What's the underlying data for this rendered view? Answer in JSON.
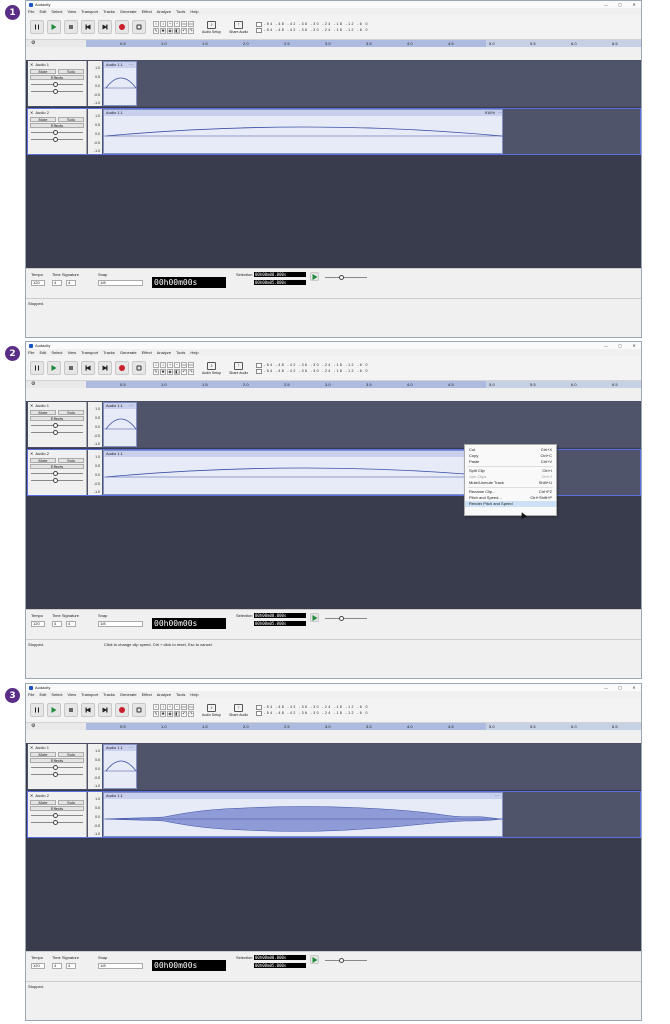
{
  "app": {
    "title": "Audacity",
    "menu": [
      "File",
      "Edit",
      "Select",
      "View",
      "Transport",
      "Tracks",
      "Generate",
      "Effect",
      "Analyze",
      "Tools",
      "Help"
    ]
  },
  "toolbar": {
    "audio_setup": "Audio Setup",
    "share_audio": "Share Audio",
    "meter_scale": "-54 -48 -42 -36 -30 -24 -18 -12 -6 0"
  },
  "ruler": {
    "ticks": [
      "0.5",
      "1.0",
      "1.5",
      "2.0",
      "2.5",
      "3.0",
      "3.5",
      "4.0",
      "4.5",
      "5.0",
      "5.5",
      "6.0",
      "6.5"
    ]
  },
  "tracks": [
    {
      "name": "Audio 1",
      "mute": "Mute",
      "solo": "Solo",
      "effects": "Effects",
      "clip_name": "Audio 1.1",
      "scale": [
        "1.0",
        "0.5",
        "0.0",
        "-0.5",
        "-1.0"
      ]
    },
    {
      "name": "Audio 2",
      "mute": "Mute",
      "solo": "Solo",
      "effects": "Effects",
      "clip_name": "Audio 1.1",
      "clip_speed": "916%",
      "scale": [
        "1.0",
        "0.5",
        "0.0",
        "-0.5",
        "-1.0"
      ]
    }
  ],
  "bottom": {
    "tempo_label": "Tempo",
    "tempo_value": "120",
    "sig_label": "Time Signature",
    "sig_num": "4",
    "sig_den": "4",
    "snap_label": "Snap",
    "snap_value": "1/8",
    "timecode": "00h00m00s",
    "selection_label": "Selection",
    "sel_start": "00h00m00.000s",
    "sel_end": "00h00m05.000s"
  },
  "status": {
    "stopped": "Stopped.",
    "hint": "Click to change clip speed, Ctrl + click to reset, Esc to cancel"
  },
  "steps": [
    "1",
    "2",
    "3"
  ],
  "context_menu": [
    {
      "label": "Cut",
      "shortcut": "Ctrl+X"
    },
    {
      "label": "Copy",
      "shortcut": "Ctrl+C"
    },
    {
      "label": "Paste",
      "shortcut": "Ctrl+V"
    },
    {
      "label": "Split Clip",
      "shortcut": "Ctrl+I"
    },
    {
      "label": "Join Clips",
      "shortcut": "Ctrl+J"
    },
    {
      "label": "Mute/Unmute Track",
      "shortcut": "Shift+U"
    },
    {
      "label": "Rename Clip...",
      "shortcut": "Ctrl+F2"
    },
    {
      "label": "Pitch and Speed...",
      "shortcut": "Ctrl+Shift+P"
    },
    {
      "label": "Render Pitch and Speed",
      "shortcut": ""
    }
  ]
}
